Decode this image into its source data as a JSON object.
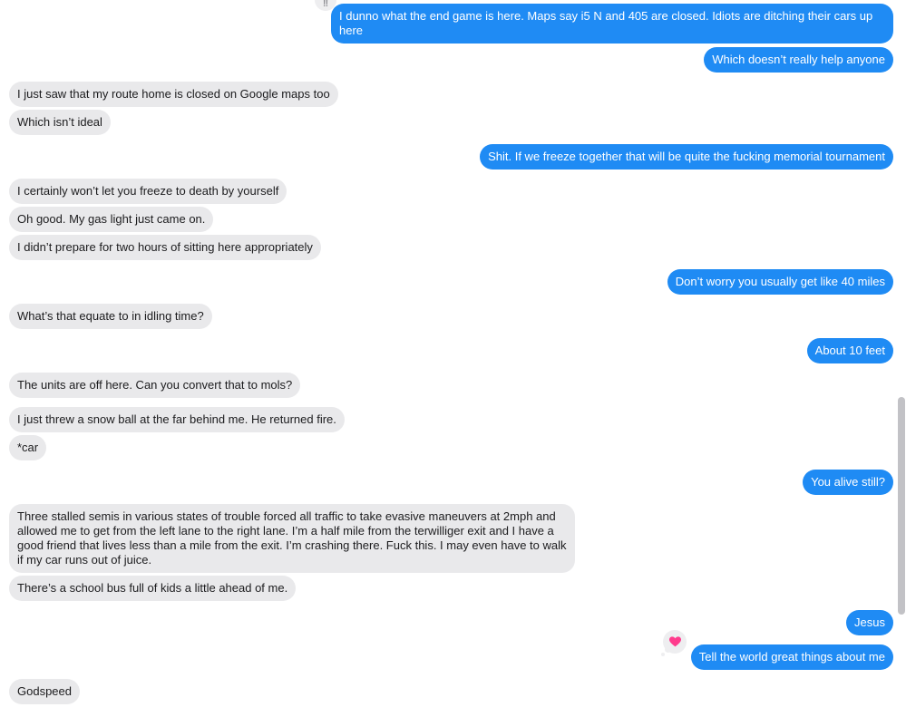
{
  "messages": [
    {
      "from": "me",
      "text": "I dunno what the end game is here. Maps say i5 N and 405 are closed. Idiots are ditching their cars up here"
    },
    {
      "from": "me",
      "text": "Which doesn’t really help anyone"
    },
    {
      "from": "them",
      "text": "I just saw that my route home is closed on Google maps too"
    },
    {
      "from": "them",
      "text": "Which isn’t ideal"
    },
    {
      "from": "me",
      "text": "Shit. If we freeze together that will be quite the fucking memorial tournament"
    },
    {
      "from": "them",
      "text": "I certainly won’t let you freeze to death by yourself"
    },
    {
      "from": "them",
      "text": "Oh good. My gas light just came on."
    },
    {
      "from": "them",
      "text": "I didn’t prepare for two hours of sitting here appropriately"
    },
    {
      "from": "me",
      "text": "Don’t worry you usually get like 40 miles"
    },
    {
      "from": "them",
      "text": "What’s that equate to in idling time?"
    },
    {
      "from": "me",
      "text": "About 10 feet"
    },
    {
      "from": "them",
      "text": "The units are off here. Can you convert that to mols?"
    },
    {
      "from": "them",
      "text": "I just threw a snow ball at the far behind me. He returned fire."
    },
    {
      "from": "them",
      "text": "*car"
    },
    {
      "from": "me",
      "text": "You alive still?"
    },
    {
      "from": "them",
      "text": "Three stalled semis in various states of trouble forced all traffic to take evasive maneuvers at 2mph and allowed me to get from the left lane to the right lane. I’m a half mile from the terwilliger exit and I have a good friend that lives less than a mile from the exit. I’m crashing there. Fuck this. I may even have to walk if my car runs out of juice."
    },
    {
      "from": "them",
      "text": "There’s a school bus full of kids a little ahead of me."
    },
    {
      "from": "me",
      "text": "Jesus"
    },
    {
      "from": "me",
      "text": "Tell the world great things about me",
      "tapback": "heart-icon"
    },
    {
      "from": "them",
      "text": "Godspeed"
    }
  ],
  "colors": {
    "outgoing": "#1f8bf4",
    "incoming": "#e9e9eb",
    "tapback_heart": "#ff3b8d"
  }
}
